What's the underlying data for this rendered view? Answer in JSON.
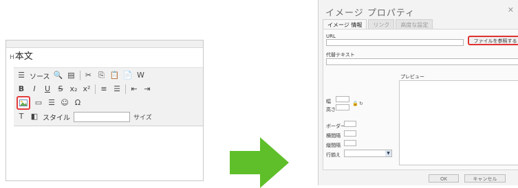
{
  "editor": {
    "label_prefix": "H",
    "label_text": "本文",
    "toolbar": {
      "source_label": "ソース",
      "style_label": "スタイル",
      "size_label": "サイズ"
    }
  },
  "dialog": {
    "title": "イメージ プロパティ",
    "close": "✕",
    "tabs": [
      {
        "label": "イメージ 情報",
        "active": true
      },
      {
        "label": "リンク",
        "active": false
      },
      {
        "label": "高度な設定",
        "active": false
      }
    ],
    "url_label": "URL",
    "browse_label": "ファイルを参照する",
    "alt_label": "代替テキスト",
    "width_label": "幅",
    "height_label": "高さ",
    "preview_label": "プレビュー",
    "border_label": "ボーダー",
    "hspace_label": "横間隔",
    "vspace_label": "縦間隔",
    "align_label": "行揃え",
    "ok_label": "OK",
    "cancel_label": "キャンセル"
  },
  "colors": {
    "highlight": "#e33b3b",
    "arrow": "#5fbf2a"
  }
}
